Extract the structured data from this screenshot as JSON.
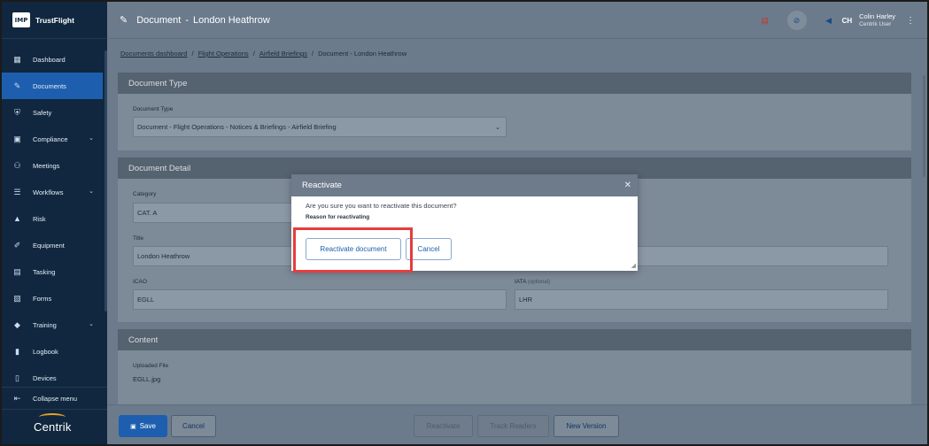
{
  "app": {
    "logo_text": "IMP",
    "name": "TrustFlight",
    "footer_brand": "Centrik"
  },
  "sidebar": {
    "items": [
      {
        "label": "Dashboard",
        "icon": "dashboard-icon",
        "glyph": "▦"
      },
      {
        "label": "Documents",
        "icon": "paperclip-icon",
        "glyph": "✎",
        "active": true
      },
      {
        "label": "Safety",
        "icon": "shield-icon",
        "glyph": "⛨"
      },
      {
        "label": "Compliance",
        "icon": "compliance-icon",
        "glyph": "▣",
        "chevron": true
      },
      {
        "label": "Meetings",
        "icon": "meetings-icon",
        "glyph": "⚇"
      },
      {
        "label": "Workflows",
        "icon": "workflows-icon",
        "glyph": "☰",
        "chevron": true
      },
      {
        "label": "Risk",
        "icon": "risk-icon",
        "glyph": "▲"
      },
      {
        "label": "Equipment",
        "icon": "wrench-icon",
        "glyph": "✐"
      },
      {
        "label": "Tasking",
        "icon": "tasking-icon",
        "glyph": "▤"
      },
      {
        "label": "Forms",
        "icon": "forms-icon",
        "glyph": "▧"
      },
      {
        "label": "Training",
        "icon": "graduation-cap-icon",
        "glyph": "◆",
        "chevron": true
      },
      {
        "label": "Logbook",
        "icon": "logbook-icon",
        "glyph": "▮"
      },
      {
        "label": "Devices",
        "icon": "devices-icon",
        "glyph": "▯"
      }
    ],
    "collapse_label": "Collapse menu"
  },
  "header": {
    "title": "Document",
    "title_sep": "-",
    "subtitle": "London Heathrow",
    "user": {
      "initials": "CH",
      "name": "Colin Harley",
      "role": "Centrik User"
    }
  },
  "breadcrumb": {
    "items": [
      "Documents dashboard",
      "Flight Operations",
      "Airfield Briefings"
    ],
    "separator": "/",
    "current": "Document - London Heathrow"
  },
  "document_type": {
    "heading": "Document Type",
    "label": "Document Type",
    "value": "Document - Flight Operations - Notices & Briefings - Airfield Briefing"
  },
  "document_detail": {
    "heading": "Document Detail",
    "category_label": "Category",
    "category_value": "CAT. A",
    "title_label": "Title",
    "title_value": "London Heathrow",
    "icao_label": "ICAO",
    "icao_value": "EGLL",
    "iata_label": "IATA",
    "iata_optional": "(optional)",
    "iata_value": "LHR"
  },
  "content": {
    "heading": "Content",
    "uploaded_label": "Uploaded File",
    "uploaded_value": "EGLL.jpg"
  },
  "footer": {
    "save": "Save",
    "cancel": "Cancel",
    "reactivate": "Reactivate",
    "track_readers": "Track Readers",
    "new_version": "New Version"
  },
  "modal": {
    "title": "Reactivate",
    "question": "Are you sure you want to reactivate this document?",
    "reason_label": "Reason for reactivating",
    "confirm": "Reactivate document",
    "cancel": "Cancel"
  }
}
